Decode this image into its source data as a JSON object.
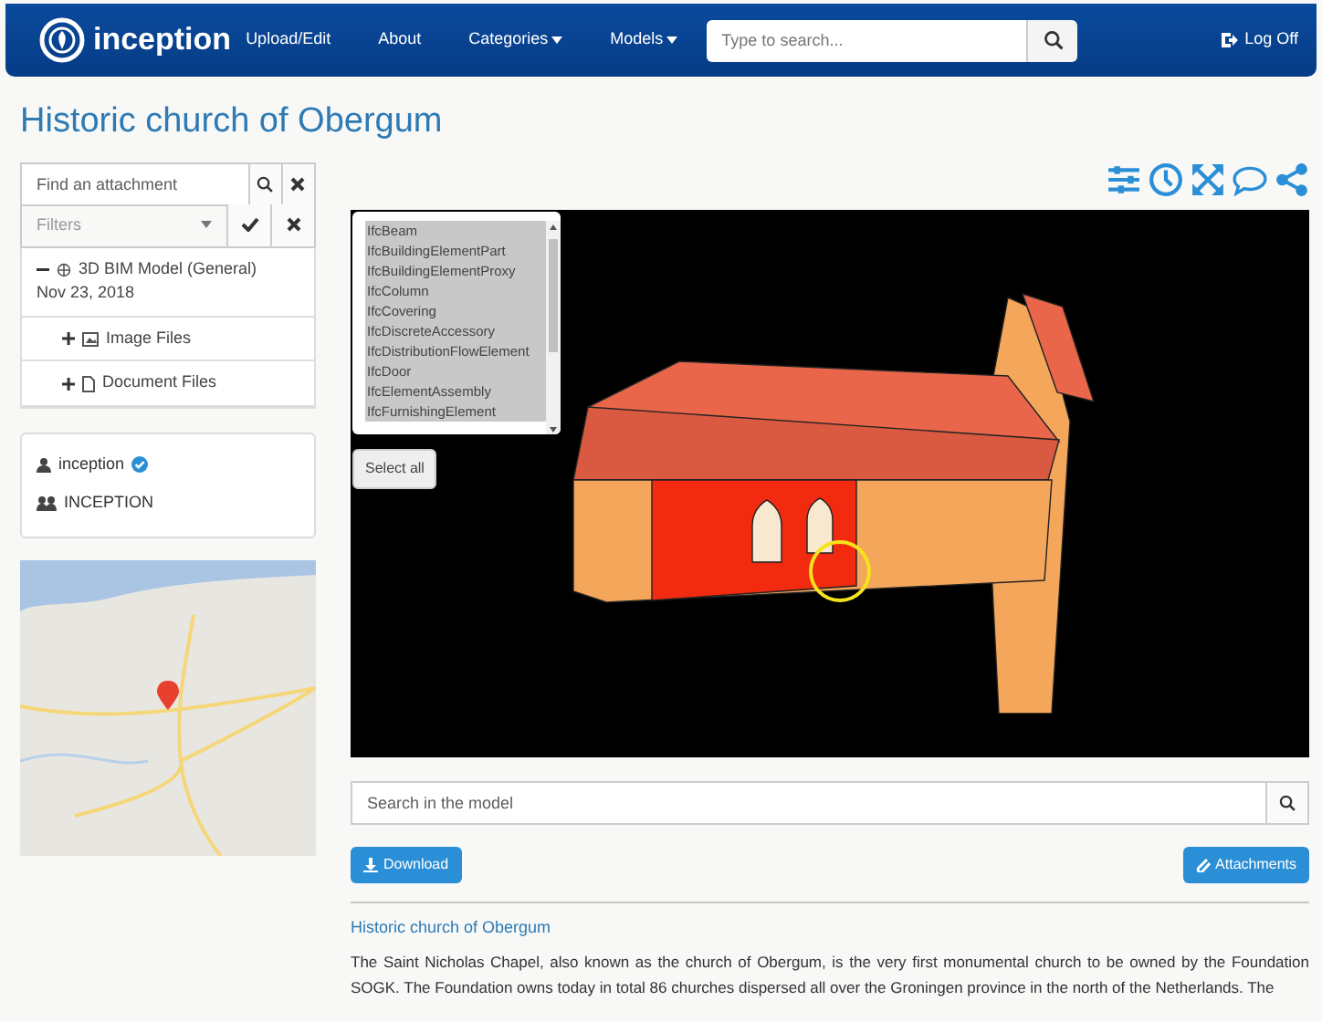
{
  "navbar": {
    "brand": "inception",
    "links": [
      {
        "label": "Upload/Edit",
        "dropdown": false
      },
      {
        "label": "About",
        "dropdown": false
      },
      {
        "label": "Categories",
        "dropdown": true
      },
      {
        "label": "Models",
        "dropdown": true
      }
    ],
    "search": {
      "placeholder": "Type to search..."
    },
    "logoff": "Log Off"
  },
  "title": "Historic church of Obergum",
  "attachment_search": {
    "placeholder": "Find an attachment"
  },
  "filters": {
    "placeholder": "Filters"
  },
  "attachments": [
    {
      "kind": "model",
      "label": "3D BIM Model (General)",
      "date": "Nov 23, 2018",
      "expanded": true,
      "children": [
        {
          "kind": "image",
          "label": "Image Files",
          "expanded": false
        },
        {
          "kind": "document",
          "label": "Document Files",
          "expanded": false
        }
      ]
    }
  ],
  "owner": {
    "user": "inception",
    "verified": true,
    "group": "INCEPTION"
  },
  "ifc_types": [
    {
      "label": "IfcBeam",
      "selected": true
    },
    {
      "label": "IfcBuildingElementPart",
      "selected": true
    },
    {
      "label": "IfcBuildingElementProxy",
      "selected": true
    },
    {
      "label": "IfcColumn",
      "selected": true
    },
    {
      "label": "IfcCovering",
      "selected": true
    },
    {
      "label": "IfcDiscreteAccessory",
      "selected": true
    },
    {
      "label": "IfcDistributionFlowElement",
      "selected": true
    },
    {
      "label": "IfcDoor",
      "selected": true
    },
    {
      "label": "IfcElementAssembly",
      "selected": true
    },
    {
      "label": "IfcFurnishingElement",
      "selected": true
    }
  ],
  "select_all": "Select all",
  "model_search": {
    "placeholder": "Search in the model"
  },
  "buttons": {
    "download": "Download",
    "attachments": "Attachments"
  },
  "description": {
    "heading": "Historic church of Obergum",
    "text": "The Saint Nicholas Chapel, also known as the church of Obergum, is the very first monumental church to be owned by the Foundation SOGK. The Foundation owns today in total 86 churches dispersed all over the Groningen province in the north of the Netherlands. The"
  }
}
